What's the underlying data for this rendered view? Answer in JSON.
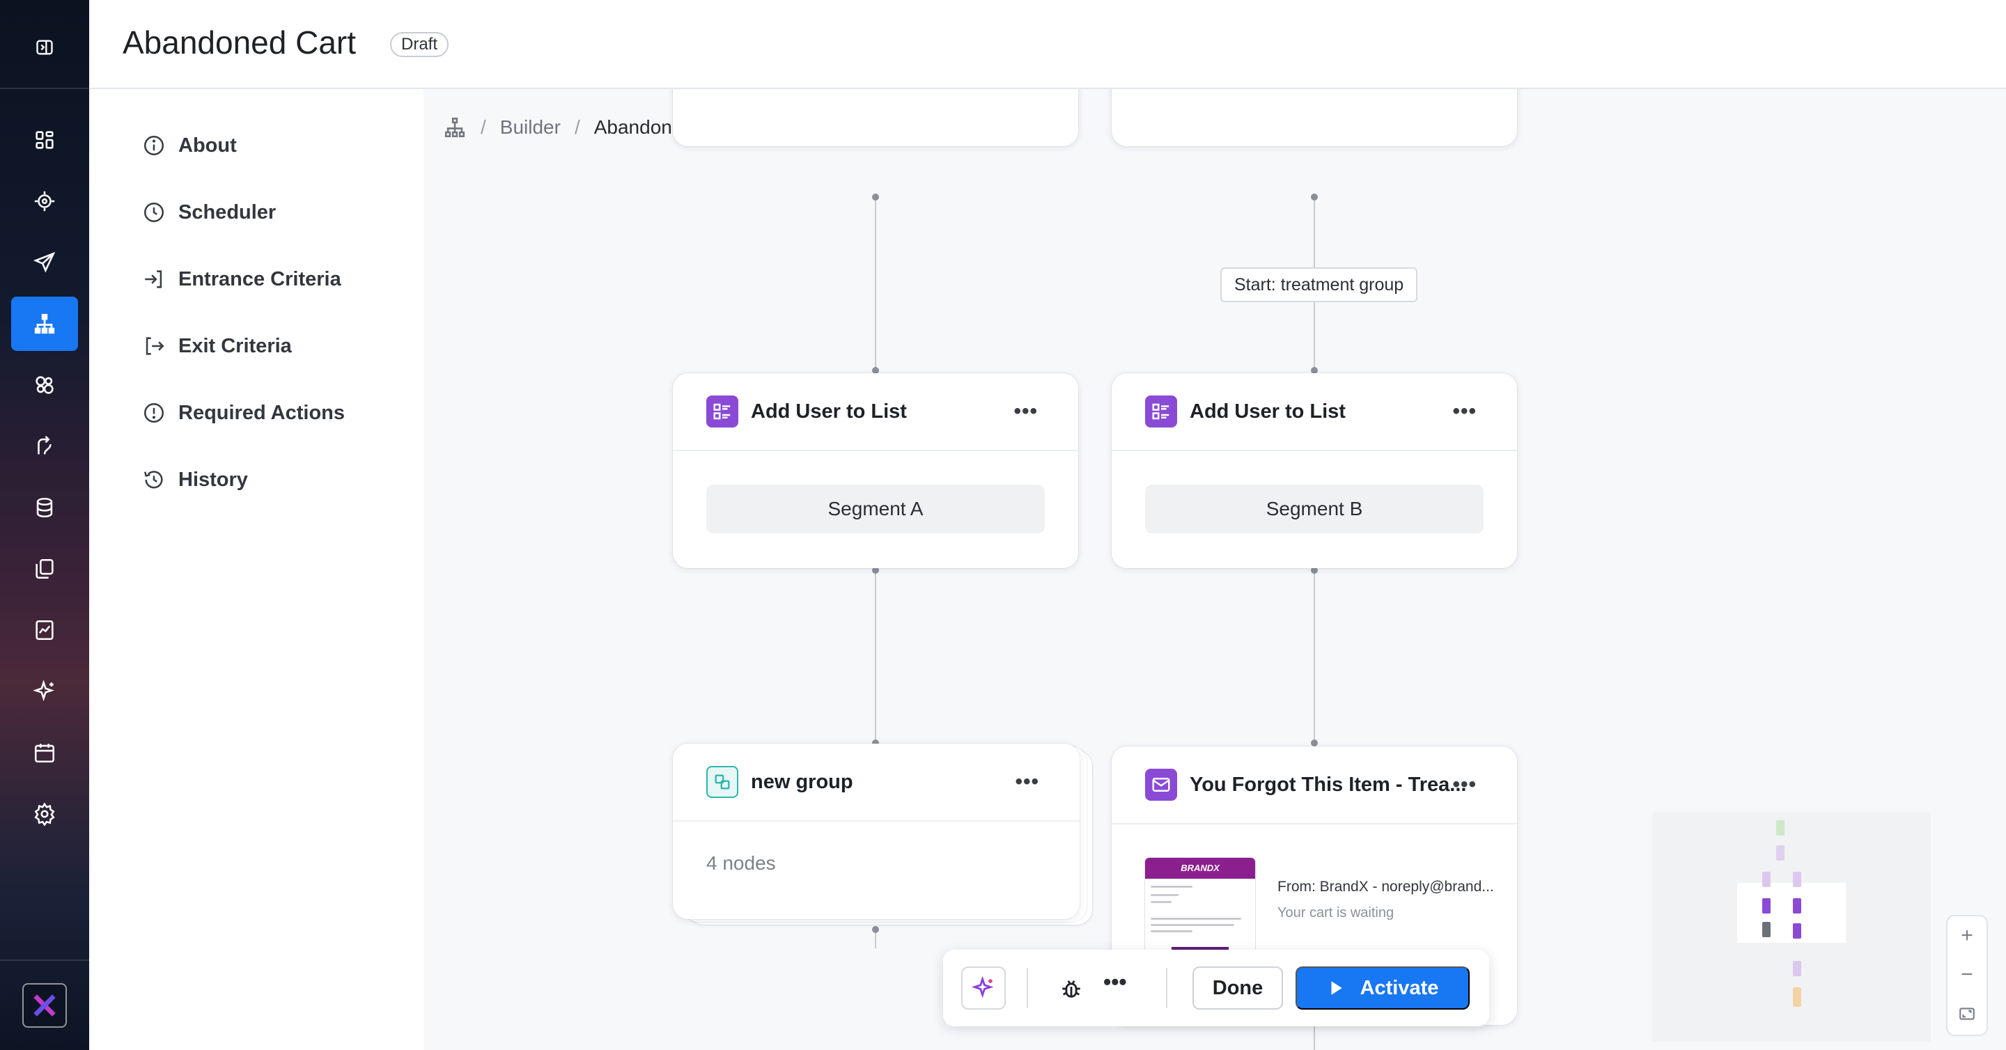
{
  "header": {
    "title": "Abandoned Cart",
    "status_badge": "Draft"
  },
  "sidebar": {
    "items": [
      {
        "label": "About",
        "icon": "info-icon"
      },
      {
        "label": "Scheduler",
        "icon": "clock-icon"
      },
      {
        "label": "Entrance Criteria",
        "icon": "enter-icon"
      },
      {
        "label": "Exit Criteria",
        "icon": "exit-icon"
      },
      {
        "label": "Required Actions",
        "icon": "alert-icon"
      },
      {
        "label": "History",
        "icon": "history-icon"
      }
    ]
  },
  "breadcrumb": {
    "section": "Builder",
    "current": "Abandoned Cart"
  },
  "canvas": {
    "branch_label": "Start: treatment group",
    "nodes": {
      "add_list_a": {
        "title": "Add User to List",
        "segment": "Segment A"
      },
      "add_list_b": {
        "title": "Add User to List",
        "segment": "Segment B"
      },
      "group": {
        "title": "new group",
        "detail": "4 nodes"
      },
      "email": {
        "title": "You Forgot This Item - Trea...",
        "from": "From: BrandX - noreply@brand...",
        "subject": "Your cart is waiting",
        "thumb_brand": "BRANDX"
      }
    }
  },
  "toolbar": {
    "done_label": "Done",
    "activate_label": "Activate"
  },
  "colors": {
    "accent": "#1877f2",
    "node_icon": "#8a4ad6",
    "group_icon": "#2fb5ad"
  }
}
